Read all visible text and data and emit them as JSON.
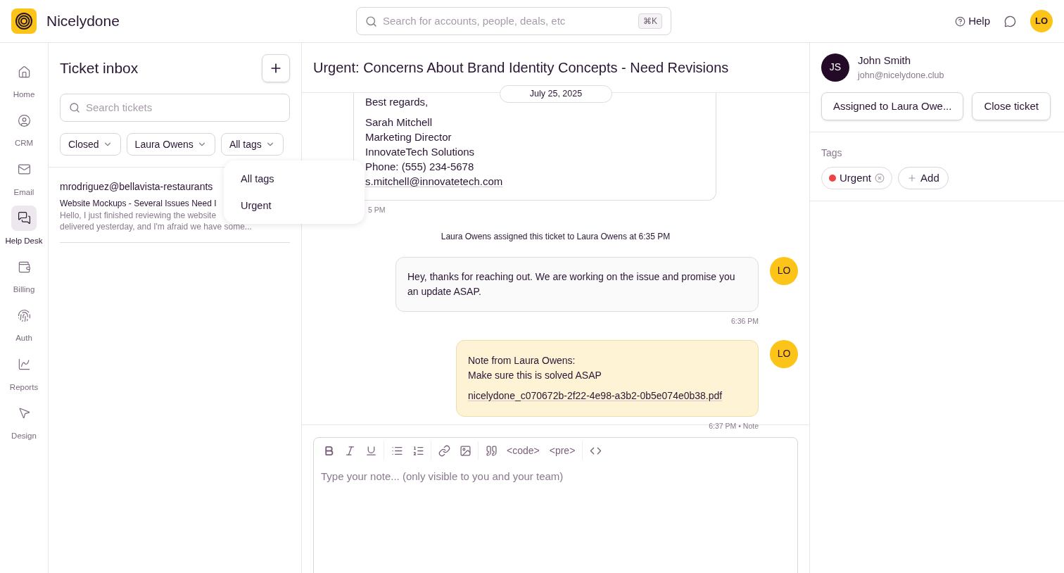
{
  "app": {
    "name": "Nicelydone"
  },
  "search": {
    "placeholder": "Search for accounts, people, deals, etc",
    "shortcut": "⌘K"
  },
  "header": {
    "help": "Help",
    "avatar": "LO"
  },
  "sidebar": {
    "items": [
      {
        "label": "Home",
        "selected": false
      },
      {
        "label": "CRM",
        "selected": false
      },
      {
        "label": "Email",
        "selected": false
      },
      {
        "label": "Help Desk",
        "selected": true
      },
      {
        "label": "Billing",
        "selected": false
      },
      {
        "label": "Auth",
        "selected": false
      },
      {
        "label": "Reports",
        "selected": false
      },
      {
        "label": "Design",
        "selected": false
      }
    ]
  },
  "inbox": {
    "title": "Ticket inbox",
    "search_placeholder": "Search tickets",
    "filters": [
      {
        "label": "Closed"
      },
      {
        "label": "Laura Owens"
      },
      {
        "label": "All tags"
      }
    ],
    "tickets": [
      {
        "sender": "mrodriguez@bellavista-restaurants",
        "subject": "Website Mockups - Several Issues Need I",
        "preview": [
          "Hello, I just finished reviewing the website",
          "delivered yesterday, and I'm afraid we have some..."
        ]
      }
    ],
    "dropdown": {
      "items": [
        "All tags",
        "Urgent"
      ]
    }
  },
  "conversation": {
    "title": "Urgent: Concerns About Brand Identity Concepts - Need Revisions",
    "date": "July 25, 2025",
    "email": {
      "greeting": "Best regards,",
      "signature": [
        "Sarah Mitchell",
        "Marketing Director",
        "InnovateTech Solutions",
        "Phone: (555) 234-5678"
      ],
      "link": "s.mitchell@innovatetech.com",
      "time": "5 PM"
    },
    "events": [
      {
        "kind": "system",
        "text": "Laura Owens assigned this ticket to Laura Owens at 6:35 PM"
      },
      {
        "kind": "reply",
        "text": "Hey, thanks for reaching out. We are working on the issue and promise you an update ASAP.",
        "avatar": "LO",
        "time": "6:36 PM"
      },
      {
        "kind": "note",
        "heading": "Note from Laura Owens:",
        "text": "Make sure this is solved ASAP",
        "attachment": "nicelydone_c070672b-2f22-4e98-a3b2-0b5e074e0b38.pdf",
        "avatar": "LO",
        "time": "6:37 PM • Note"
      }
    ]
  },
  "editor": {
    "toolbar": [
      {
        "kind": "bold"
      },
      {
        "kind": "italic"
      },
      {
        "kind": "underline"
      },
      {
        "kind": "divider"
      },
      {
        "kind": "bullets"
      },
      {
        "kind": "numbers"
      },
      {
        "kind": "divider"
      },
      {
        "kind": "link"
      },
      {
        "kind": "image"
      },
      {
        "kind": "divider"
      },
      {
        "kind": "quote"
      },
      {
        "kind": "text",
        "label": "<code>"
      },
      {
        "kind": "text",
        "label": "<pre>"
      },
      {
        "kind": "divider"
      },
      {
        "kind": "source"
      }
    ],
    "placeholder": "Type your note... (only visible to you and your team)"
  },
  "contact": {
    "initials": "JS",
    "name": "John Smith",
    "email": "john@nicelydone.club",
    "buttons": [
      "Assigned to Laura Owe...",
      "Close ticket"
    ]
  },
  "tags": {
    "label": "Tags",
    "items": [
      {
        "label": "Urgent",
        "color": "#ef4444"
      }
    ],
    "add": "Add"
  }
}
